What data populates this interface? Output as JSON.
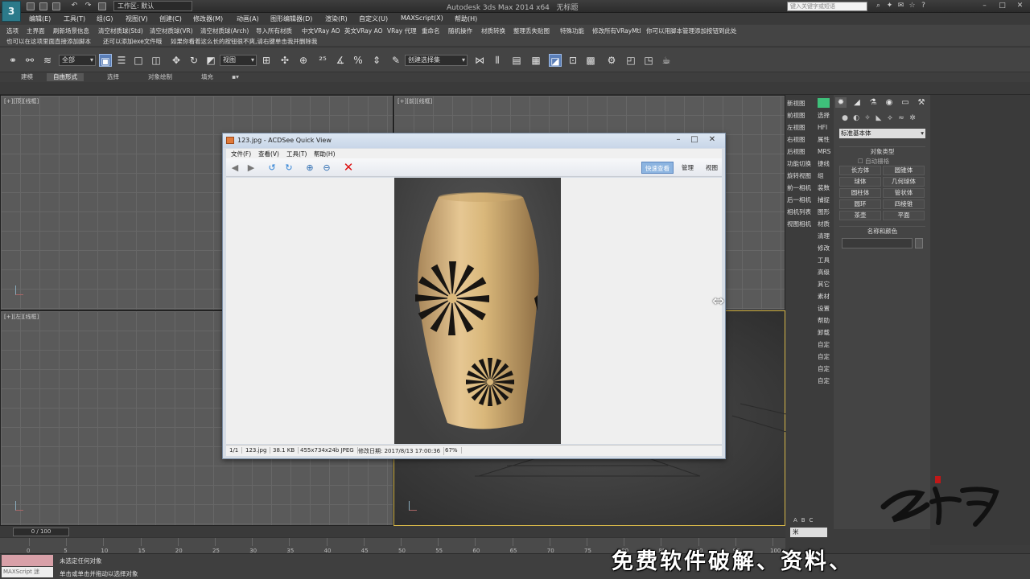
{
  "app": {
    "title": "Autodesk 3ds Max  2014 x64",
    "doc": "无标题",
    "workspace": "工作区: 默认",
    "search_placeholder": "键入关键字或短语",
    "logo": "3"
  },
  "menu": [
    "编辑(E)",
    "工具(T)",
    "组(G)",
    "视图(V)",
    "创建(C)",
    "修改器(M)",
    "动画(A)",
    "图形编辑器(D)",
    "渲染(R)",
    "自定义(U)",
    "MAXScript(X)",
    "帮助(H)"
  ],
  "custom_toolbar_1": [
    "选项",
    "主界面",
    "刷新场景信息",
    "清空材质球(Std)",
    "清空材质球(VR)",
    "清空材质球(Arch)",
    "导入所有材质",
    "中文VRay AO",
    "英文VRay AO",
    "VRay 代理",
    "重命名",
    "随机操作",
    "材质转换",
    "整理丢失贴图",
    "特殊功能",
    "修改所有VRayMtl",
    "你可以用脚本管理添加按钮到此处"
  ],
  "custom_toolbar_2": [
    "也可以在这项里面直接添加脚本",
    "还可以添加exe文件哦",
    "如果你看着这么长的按钮很不爽,请右键单击我并删除我"
  ],
  "main_toolbar": {
    "selection_filter": "全部",
    "ref_coord": "视图",
    "named_selection": "创建选择集"
  },
  "ribbon_tabs": [
    "建模",
    "自由形式",
    "选择",
    "对象绘制",
    "填充"
  ],
  "ribbon_active": "自由形式",
  "viewports": {
    "top": "[+][顶][线框]",
    "front": "[+][前][线框]",
    "left": "[+][左][线框]"
  },
  "viewport_buttons": [
    {
      "label": "新视图",
      "side": ""
    },
    {
      "label": "前视图",
      "side": "选择"
    },
    {
      "label": "左视图",
      "side": "HFI"
    },
    {
      "label": "右视图",
      "side": "属性"
    },
    {
      "label": "后视图",
      "side": "MRS"
    },
    {
      "label": "功能切换",
      "side": "捷线"
    },
    {
      "label": "旋转视图",
      "side": "组"
    },
    {
      "label": "前一相机",
      "side": "装数"
    },
    {
      "label": "后一相机",
      "side": "捕捉"
    },
    {
      "label": "相机列表",
      "side": "图形"
    },
    {
      "label": "视图相机",
      "side": "材质"
    },
    {
      "label": "",
      "side": "清理"
    },
    {
      "label": "",
      "side": "修改"
    },
    {
      "label": "",
      "side": "工具"
    },
    {
      "label": "",
      "side": "高级"
    },
    {
      "label": "",
      "side": "其它"
    },
    {
      "label": "",
      "side": "素材"
    },
    {
      "label": "",
      "side": "设置"
    },
    {
      "label": "",
      "side": "帮助"
    },
    {
      "label": "",
      "side": "卸载"
    },
    {
      "label": "",
      "side": "自定"
    },
    {
      "label": "",
      "side": "自定"
    },
    {
      "label": "",
      "side": "自定"
    },
    {
      "label": "",
      "side": "自定"
    }
  ],
  "command_panel": {
    "category": "标准基本体",
    "object_type_title": "对象类型",
    "autogrid": "自动栅格",
    "objects": [
      "长方体",
      "圆锥体",
      "球体",
      "几何球体",
      "圆柱体",
      "管状体",
      "圆环",
      "四棱锥",
      "茶壶",
      "平面"
    ],
    "name_color_title": "名称和颜色"
  },
  "acdsee": {
    "title": "123.jpg - ACDSee Quick View",
    "menu": [
      "文件(F)",
      "查看(V)",
      "工具(T)",
      "帮助(H)"
    ],
    "tabs": [
      "快速查看",
      "管理",
      "视图"
    ],
    "active_tab": "快速查看",
    "status": [
      "1/1",
      "123.jpg",
      "38.1 KB",
      "455x734x24b JPEG",
      "修改日期: 2017/8/13 17:00:36",
      "67%"
    ]
  },
  "timeline": {
    "frame": "0 / 100",
    "ticks": [
      "0",
      "5",
      "10",
      "15",
      "20",
      "25",
      "30",
      "35",
      "40",
      "45",
      "50",
      "55",
      "60",
      "65",
      "70",
      "75",
      "80",
      "85",
      "90",
      "95",
      "100"
    ]
  },
  "status": {
    "maxscript": "MAXScript 迷",
    "line1": "未选定任何对象",
    "line2": "单击或单击并拖动以选择对象",
    "units": "米",
    "abc": "ABC"
  },
  "overlay": {
    "promo": "免费软件破解、资料、"
  },
  "colors": {
    "accent_blue": "#5b7fb8",
    "viewport_active_border": "#d9b94a",
    "vase": "#d9b77a",
    "green_button": "#3ec07a"
  }
}
